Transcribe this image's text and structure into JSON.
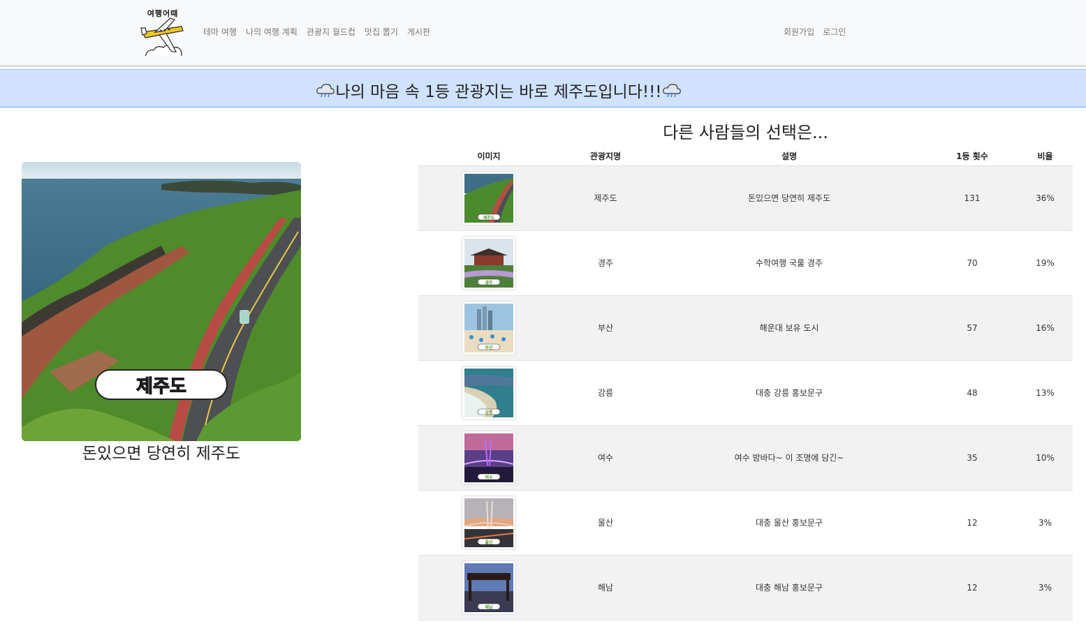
{
  "nav": {
    "logo_text": "여행어때",
    "links": [
      "테마 여행",
      "나의 여행 계획",
      "관광지 월드컵",
      "맛집 뽑기",
      "게시판"
    ],
    "right": [
      "회원가입",
      "로그인"
    ]
  },
  "banner": {
    "text": "나의 마음 속 1등 관광지는 바로 제주도입니다!!!"
  },
  "winner": {
    "label": "제주도",
    "description": "돈있으면 당연히 제주도"
  },
  "others": {
    "title": "다른 사람들의 선택은...",
    "columns": [
      "이미지",
      "관광지명",
      "설명",
      "1등 횟수",
      "비율"
    ],
    "rows": [
      {
        "name": "제주도",
        "desc": "돈있으면 당연히 제주도",
        "count": "131",
        "ratio": "36%",
        "thumb_label": "제주도"
      },
      {
        "name": "경주",
        "desc": "수학여행 국룰 경주",
        "count": "70",
        "ratio": "19%",
        "thumb_label": "경주"
      },
      {
        "name": "부산",
        "desc": "해운대 보유 도시",
        "count": "57",
        "ratio": "16%",
        "thumb_label": "부산"
      },
      {
        "name": "강릉",
        "desc": "대충 강릉 홍보문구",
        "count": "48",
        "ratio": "13%",
        "thumb_label": "강릉"
      },
      {
        "name": "여수",
        "desc": "여수 밤바다~ 이 조명에 담긴~",
        "count": "35",
        "ratio": "10%",
        "thumb_label": "여수"
      },
      {
        "name": "울산",
        "desc": "대충 울산 홍보문구",
        "count": "12",
        "ratio": "3%",
        "thumb_label": "울산"
      },
      {
        "name": "해남",
        "desc": "대충 해남 홍보문구",
        "count": "12",
        "ratio": "3%",
        "thumb_label": "해남"
      }
    ]
  }
}
